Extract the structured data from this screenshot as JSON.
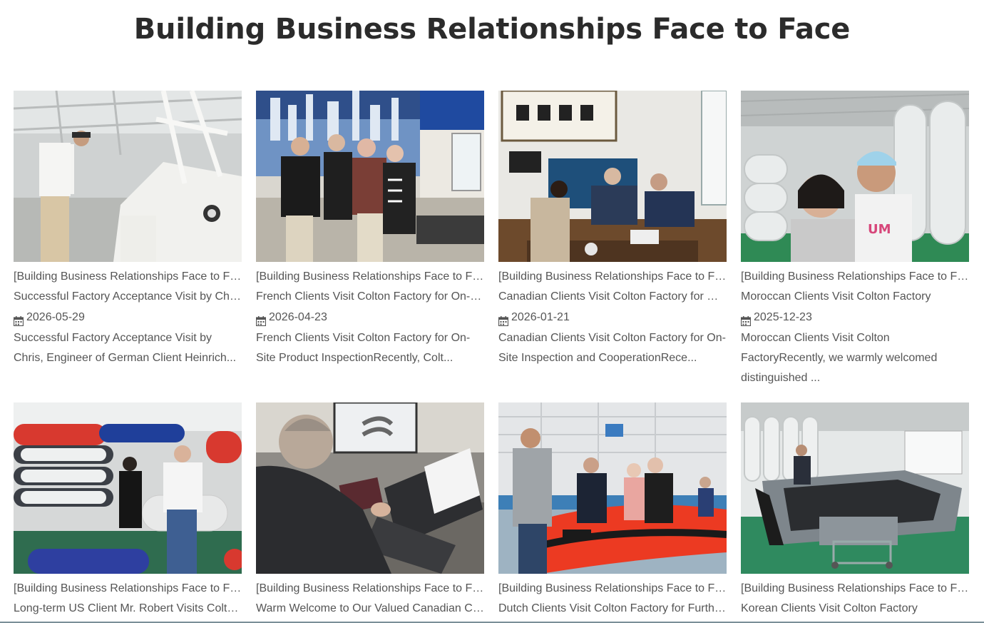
{
  "page": {
    "title": "Building Business Relationships Face to Face"
  },
  "posts": [
    {
      "category": "[Building Business Relationships Face to Face]",
      "title": "Successful Factory Acceptance Visit by Chris, Engineer of German Client Heinrich",
      "date": "2026-05-29",
      "excerpt": "Successful Factory Acceptance Visit by Chris, Engineer of German Client Heinrich...",
      "image": "man-inspecting-white-boat-helm"
    },
    {
      "category": "[Building Business Relationships Face to Face]",
      "title": "French Clients Visit Colton Factory for On-Site Product Inspection",
      "date": "2026-04-23",
      "excerpt": "French Clients Visit Colton Factory for On-Site Product InspectionRecently, Colt...",
      "image": "four-people-office-photo"
    },
    {
      "category": "[Building Business Relationships Face to Face]",
      "title": "Canadian Clients Visit Colton Factory for On-Site Inspection and Cooperation",
      "date": "2026-01-21",
      "excerpt": "Canadian Clients Visit Colton Factory for On-Site Inspection and CooperationRece...",
      "image": "tea-table-meeting"
    },
    {
      "category": "[Building Business Relationships Face to Face]",
      "title": "Moroccan Clients Visit Colton Factory",
      "date": "2025-12-23",
      "excerpt": "Moroccan Clients Visit Colton FactoryRecently, we warmly welcomed distinguished ...",
      "image": "selfie-with-inflatable-boats"
    },
    {
      "category": "[Building Business Relationships Face to Face]",
      "title": "Long-term US Client Mr. Robert Visits Colton Factory",
      "image": "warehouse-inflatable-boats"
    },
    {
      "category": "[Building Business Relationships Face to Face]",
      "title": "Warm Welcome to Our Valued Canadian Client",
      "image": "client-at-laptop"
    },
    {
      "category": "[Building Business Relationships Face to Face]",
      "title": "Dutch Clients Visit Colton Factory for Further Cooperation",
      "image": "group-with-red-boat"
    },
    {
      "category": "[Building Business Relationships Face to Face]",
      "title": "Korean Clients Visit Colton Factory",
      "image": "grey-aluminium-hull"
    }
  ],
  "icons": {
    "date": "calendar-icon"
  },
  "colors": {
    "text": "#555555",
    "heading": "#2b2b2b"
  }
}
